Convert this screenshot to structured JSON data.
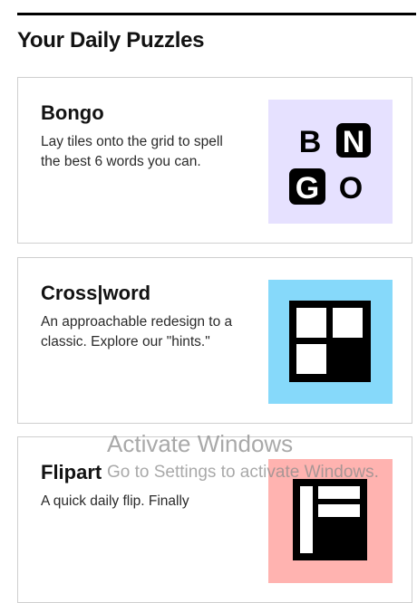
{
  "section": {
    "title": "Your Daily Puzzles"
  },
  "cards": [
    {
      "title": "Bongo",
      "description": "Lay tiles onto the grid to spell the best 6 words you can.",
      "thumb_bg": "#e6e1ff",
      "icon": "bongo-tiles-icon",
      "tile_letters": [
        "B",
        "N",
        "G",
        "O"
      ]
    },
    {
      "title": "Cross|word",
      "description": "An approachable redesign to a classic. Explore our \"hints.\"",
      "thumb_bg": "#86d9fa",
      "icon": "crossword-grid-icon"
    },
    {
      "title": "Flipart",
      "description": "A quick daily flip. Finally",
      "thumb_bg": "#ffb3b0",
      "icon": "flipart-icon"
    }
  ],
  "watermark": {
    "title": "Activate Windows",
    "subtitle": "Go to Settings to activate Windows."
  }
}
